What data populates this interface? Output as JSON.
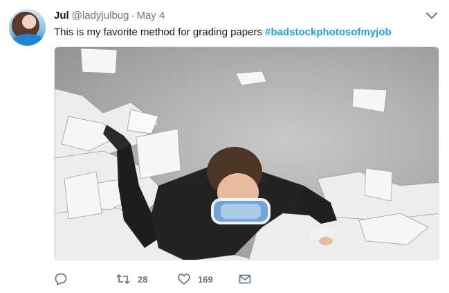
{
  "tweet": {
    "author_name": "Jul",
    "handle": "@ladyjulbug",
    "separator": "·",
    "date": "May 4",
    "text": "This is my favorite method for grading papers ",
    "hashtag": "#badstockphotosofmyjob"
  },
  "actions": {
    "replies": "",
    "retweets": "28",
    "likes": "169"
  },
  "icons": {
    "avatar": "profile-photo",
    "menu": "chevron-down-icon",
    "reply": "reply-icon",
    "retweet": "retweet-icon",
    "like": "heart-icon",
    "message": "envelope-icon"
  },
  "colors": {
    "link": "#1da1f2",
    "muted": "#657786",
    "text": "#14171a"
  }
}
